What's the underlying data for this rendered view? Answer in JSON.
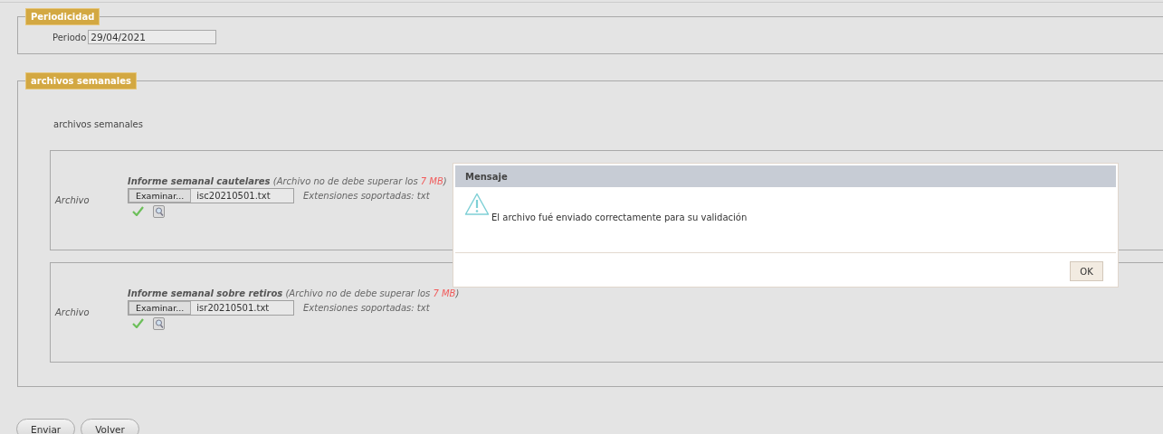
{
  "periodicidad": {
    "legend": "Periodicidad",
    "label": "Periodo",
    "value": "29/04/2021"
  },
  "archivos": {
    "legend": "archivos semanales",
    "intro": "archivos semanales",
    "uploads": [
      {
        "label": "Archivo",
        "title": "Informe semanal cautelares",
        "note": "(Archivo no de debe superar los",
        "limit": "7 MB",
        "close": ")",
        "browse": "Examinar...",
        "file": "isc20210501.txt",
        "extensions": "Extensiones soportadas: txt",
        "uploaded": true
      },
      {
        "label": "Archivo",
        "title": "Informe semanal sobre retiros",
        "note": "(Archivo no de debe superar los",
        "limit": "7 MB",
        "close": ")",
        "browse": "Examinar...",
        "file": "isr20210501.txt",
        "extensions": "Extensiones soportadas: txt",
        "uploaded": true
      }
    ]
  },
  "buttons": [
    "Enviar",
    "Volver"
  ],
  "dialog": {
    "title": "Mensaje",
    "message": "El archivo fué enviado correctamente para su validación",
    "button": "OK"
  }
}
